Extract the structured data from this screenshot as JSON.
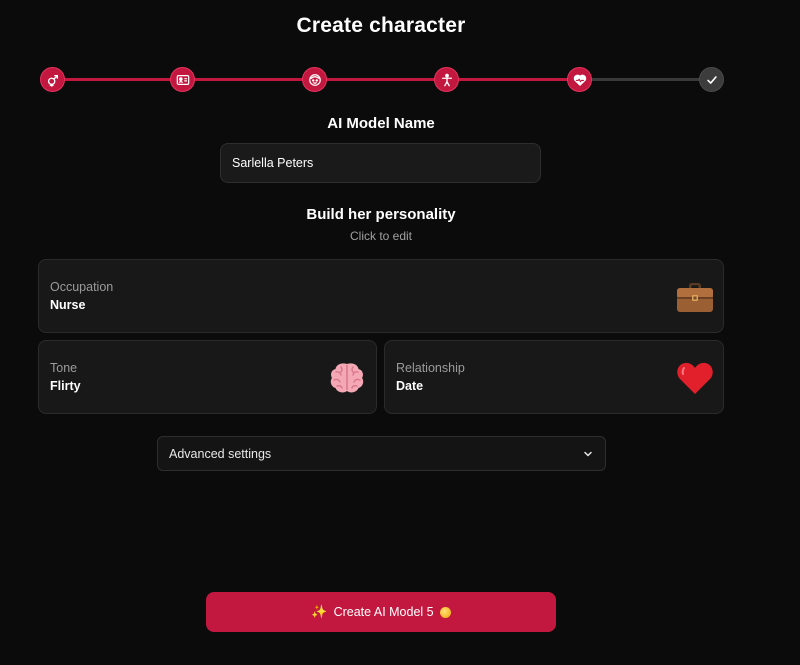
{
  "header": {
    "title": "Create character"
  },
  "stepper": {
    "steps": [
      {
        "icon": "gender-icon",
        "status": "done"
      },
      {
        "icon": "id-card-icon",
        "status": "done"
      },
      {
        "icon": "face-icon",
        "status": "done"
      },
      {
        "icon": "body-icon",
        "status": "done"
      },
      {
        "icon": "heart-pulse-icon",
        "status": "current"
      },
      {
        "icon": "check-icon",
        "status": "todo"
      }
    ],
    "accent": "#c2183f"
  },
  "name_section": {
    "label": "AI Model Name",
    "value": "Sarlella Peters"
  },
  "personality": {
    "title": "Build her personality",
    "hint": "Click to edit",
    "cards": [
      {
        "label": "Occupation",
        "value": "Nurse",
        "icon": "briefcase-icon"
      },
      {
        "label": "Tone",
        "value": "Flirty",
        "icon": "brain-icon"
      },
      {
        "label": "Relationship",
        "value": "Date",
        "icon": "heart-icon"
      }
    ]
  },
  "advanced": {
    "label": "Advanced settings"
  },
  "create_button": {
    "prefix_icon": "sparkles-icon",
    "label": "Create AI Model 5",
    "suffix_icon": "coin-icon"
  }
}
